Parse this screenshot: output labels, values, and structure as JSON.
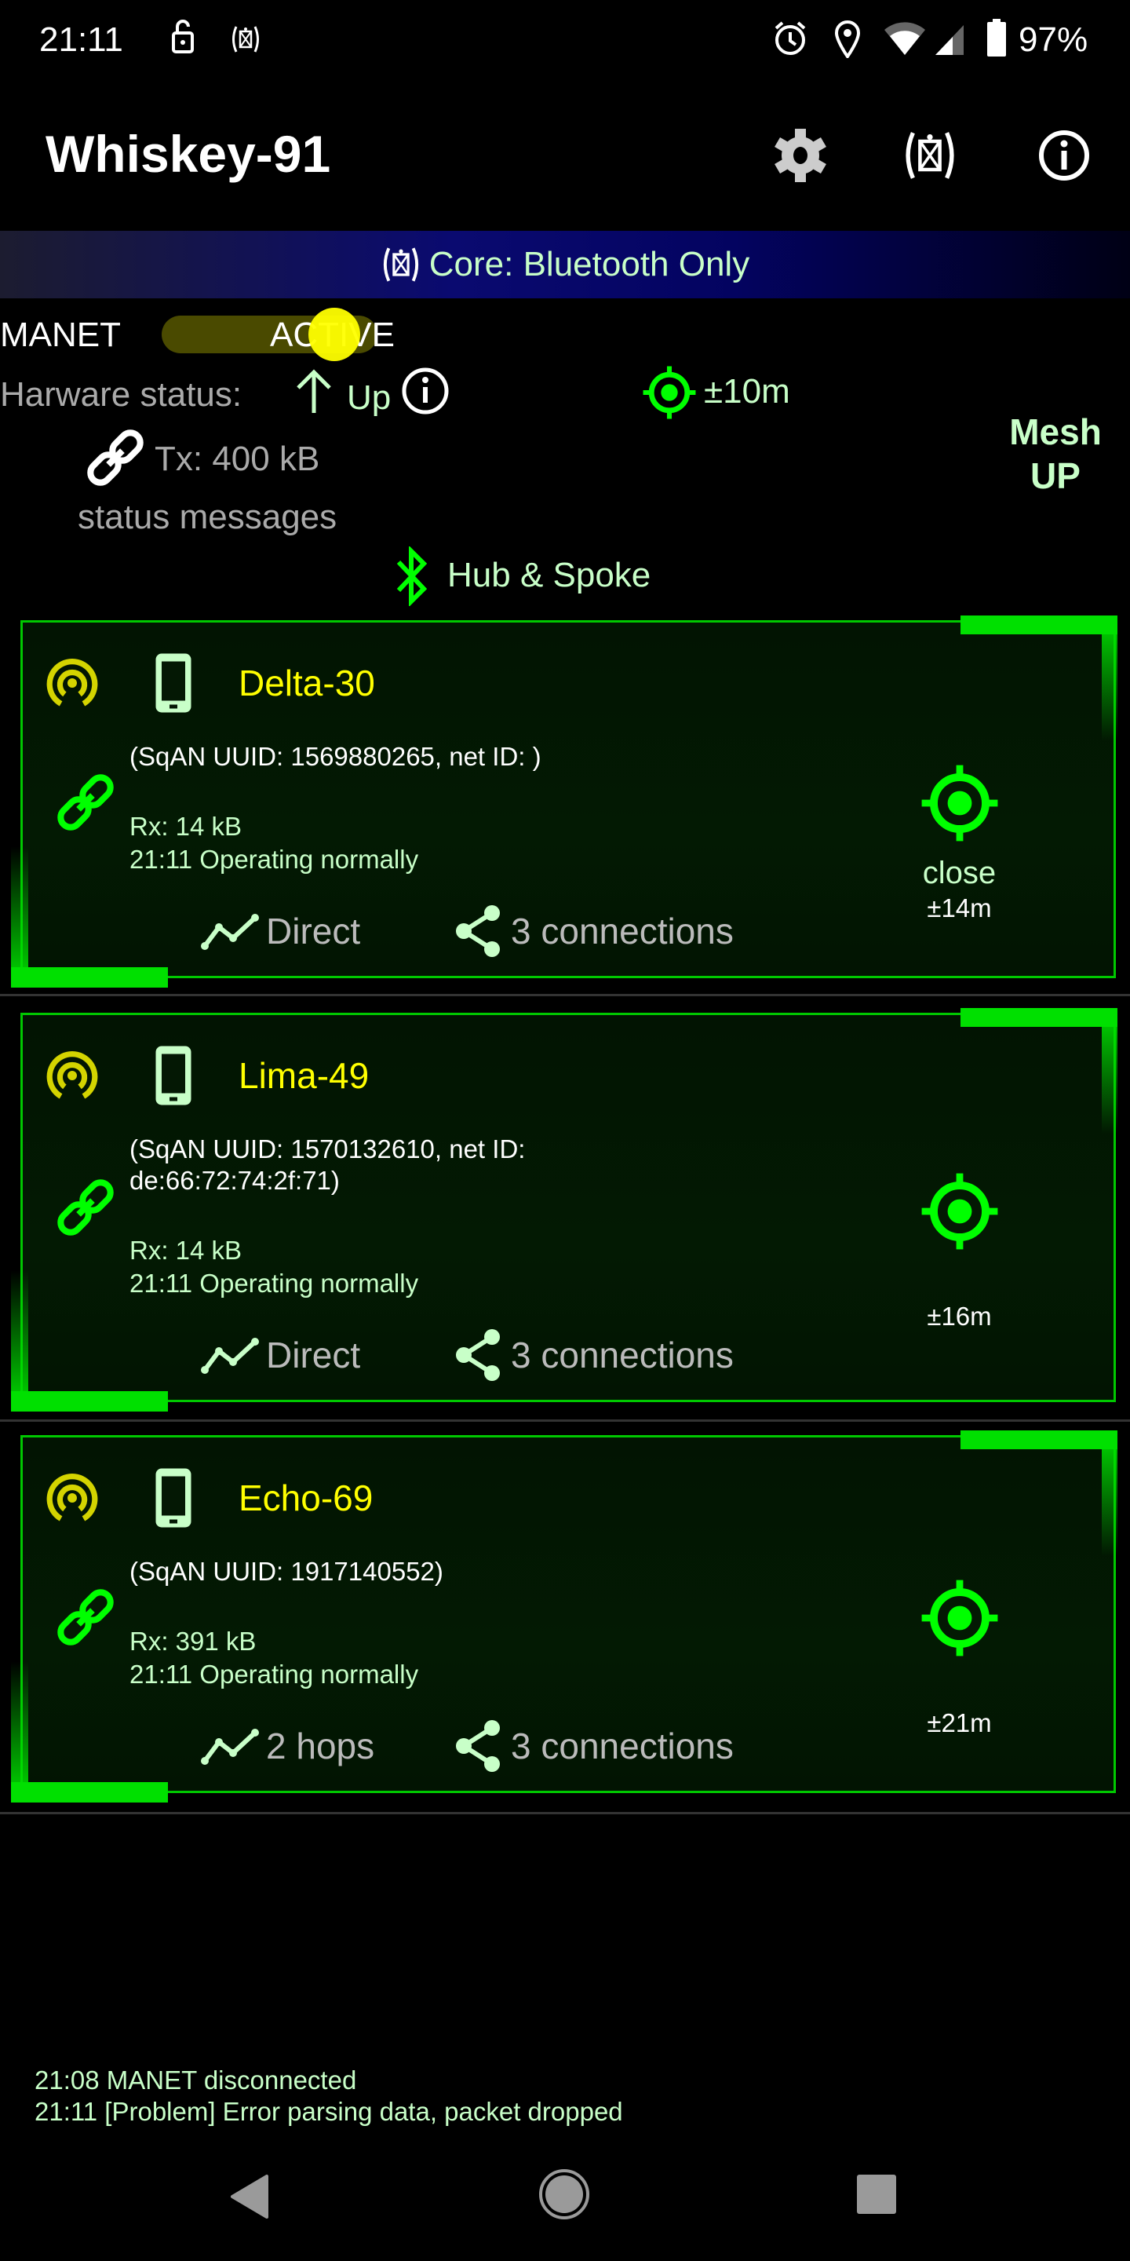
{
  "status_bar": {
    "time": "21:11",
    "battery": "97%",
    "icons": [
      "lock-open-icon",
      "radio-envelope-icon",
      "alarm-icon",
      "location-icon",
      "wifi-icon",
      "signal-icon",
      "battery-icon"
    ]
  },
  "app_bar": {
    "title": "Whiskey-91",
    "actions": [
      "settings-icon",
      "core-icon",
      "info-icon"
    ]
  },
  "banner": {
    "text": "Core: Bluetooth Only"
  },
  "manet": {
    "label": "MANET",
    "state": "ACTIVE",
    "on": true
  },
  "hardware": {
    "label": "Harware status:",
    "value": "Up"
  },
  "location": {
    "accuracy": "±10m"
  },
  "mesh": {
    "line1": "Mesh",
    "line2": "UP"
  },
  "tx": {
    "text": "Tx: 400 kB"
  },
  "status_messages": "status messages",
  "topology": "Hub & Spoke",
  "devices": [
    {
      "name": "Delta-30",
      "uuid": "(SqAN UUID: 1569880265, net ID: )",
      "rx": "Rx: 14 kB",
      "status": "21:11 Operating normally",
      "route": "Direct",
      "connections": "3 connections",
      "proximity": "close",
      "accuracy": "±14m"
    },
    {
      "name": "Lima-49",
      "uuid": "(SqAN UUID: 1570132610, net ID: de:66:72:74:2f:71)",
      "rx": "Rx: 14 kB",
      "status": "21:11 Operating normally",
      "route": "Direct",
      "connections": "3 connections",
      "accuracy": "±16m"
    },
    {
      "name": "Echo-69",
      "uuid": "(SqAN UUID: 1917140552)",
      "rx": "Rx: 391 kB",
      "status": "21:11 Operating normally",
      "route": "2 hops",
      "connections": "3 connections",
      "accuracy": "±21m"
    }
  ],
  "log": [
    "21:08 MANET disconnected",
    "21:11 [Problem] Error parsing data, packet dropped"
  ],
  "colors": {
    "accent_green": "#00ff00",
    "name_yellow": "#ffff00",
    "text_light_green": "#c8ffc8",
    "banner_blue": "#0a0a70"
  }
}
